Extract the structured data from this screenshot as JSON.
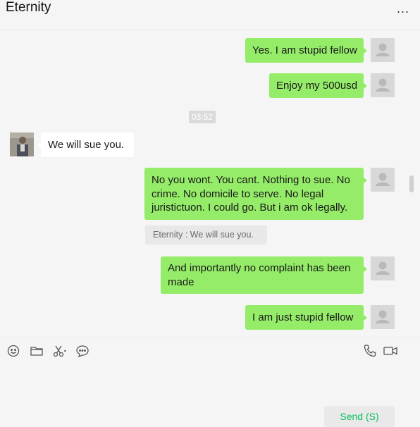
{
  "header": {
    "title": "Eternity",
    "more_label": "..."
  },
  "messages": [
    {
      "text": "Yes. I am stupid fellow"
    },
    {
      "text": "Enjoy my 500usd"
    },
    {
      "text": "We will sue  you."
    },
    {
      "text": "No you wont. You cant. Nothing to sue. No crime. No domicile to serve. No legal juristictuon. I could go. But i am ok legally."
    },
    {
      "text": "And importantly no complaint has been made"
    },
    {
      "text": "I am just stupid fellow"
    }
  ],
  "timestamp": "03:52",
  "quote": "Eternity : We will sue  you.",
  "toolbar": {
    "icons": [
      "emoji-icon",
      "folder-icon",
      "scissors-icon",
      "chat-bubble-icon",
      "phone-icon",
      "video-icon"
    ]
  },
  "input": {
    "value": ""
  },
  "send_label": "Send (S)",
  "colors": {
    "outgoing_bubble": "#95ec69",
    "incoming_bubble": "#ffffff",
    "background": "#f5f5f5",
    "send_text": "#07c160"
  }
}
